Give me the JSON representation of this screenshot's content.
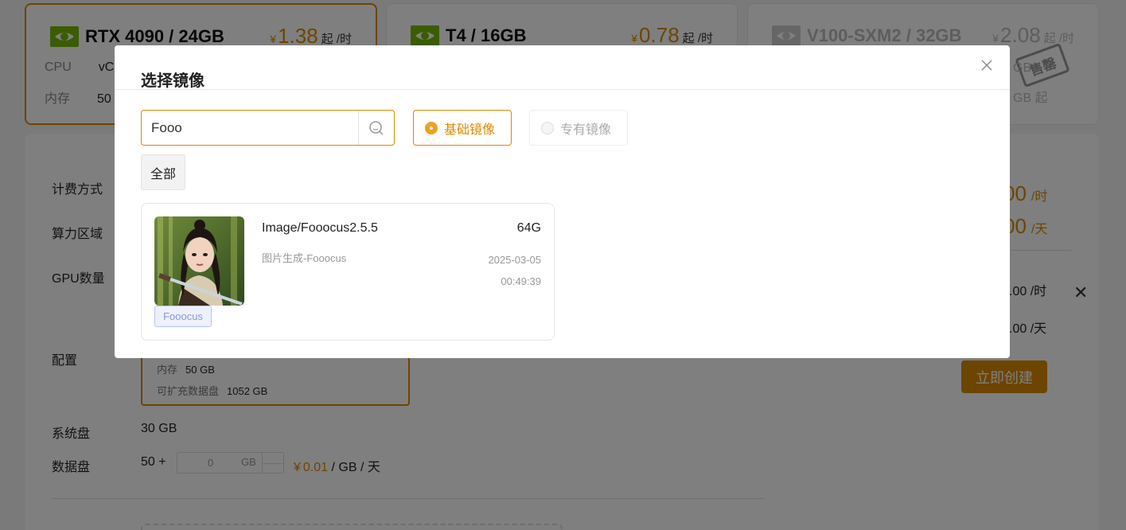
{
  "gpu_cards": [
    {
      "name": "RTX 4090 / 24GB",
      "currency": "¥",
      "price": "1.38",
      "unit": "起 /时",
      "spec1_label": "CPU",
      "spec1_value": "vC",
      "spec2_label": "内存",
      "spec2_value": "50"
    },
    {
      "name": "T4 / 16GB",
      "currency": "¥",
      "price": "0.78",
      "unit": "起 /时"
    },
    {
      "name": "V100-SXM2 / 32GB",
      "currency": "¥",
      "price": "2.08",
      "unit": "起 /时",
      "sold_label": "售罄",
      "spec1_value": "GB",
      "spec2_value": "GB 起"
    }
  ],
  "form": {
    "billing_label": "计费方式",
    "region_label": "算力区域",
    "gpu_count_label": "GPU数量",
    "config_label": "配置",
    "config_memory_label": "内存",
    "config_memory_value": "50 GB",
    "config_disk_label": "可扩充数据盘",
    "config_disk_value": "1052 GB",
    "system_disk_label": "系统盘",
    "system_disk_value": "30 GB",
    "data_disk_label": "数据盘",
    "data_disk_base": "50 +",
    "data_disk_input": "0",
    "data_disk_unit": "GB",
    "data_disk_price_cur": "¥",
    "data_disk_price": "0.01",
    "data_disk_price_unit": "/ GB / 天"
  },
  "summary": {
    "price_hour_num": "00",
    "price_hour_unit": "/时",
    "price_day_num": "00",
    "price_day_unit": "/天",
    "line1": ".00 /时",
    "line2": ".00 /天",
    "create_label": "立即创建"
  },
  "modal": {
    "title": "选择镜像",
    "search_value": "Fooo",
    "radio_basic": "基础镜像",
    "radio_private": "专有镜像",
    "tag_all": "全部",
    "card": {
      "name": "Image/Fooocus2.5.5",
      "desc": "图片生成-Fooocus",
      "size": "64G",
      "date": "2025-03-05",
      "time": "00:49:39",
      "tag": "Fooocus"
    }
  },
  "colors": {
    "accent": "#d98a00",
    "nvidia_green": "#76b900"
  }
}
